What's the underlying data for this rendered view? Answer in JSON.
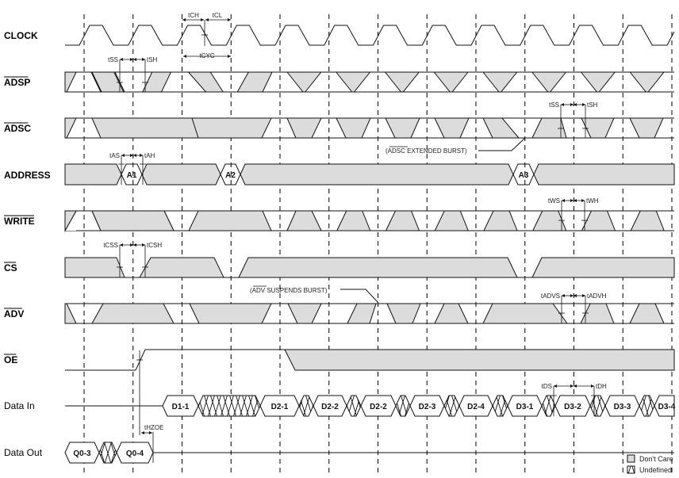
{
  "signals": [
    {
      "id": "clock",
      "label": "CLOCK",
      "overbar": false
    },
    {
      "id": "adsp",
      "label": "ADSP",
      "overbar": true
    },
    {
      "id": "adsc",
      "label": "ADSC",
      "overbar": true
    },
    {
      "id": "address",
      "label": "ADDRESS",
      "overbar": false
    },
    {
      "id": "write",
      "label": "WRITE",
      "overbar": true
    },
    {
      "id": "cs",
      "label": "CS",
      "overbar": true
    },
    {
      "id": "adv",
      "label": "ADV",
      "overbar": true
    },
    {
      "id": "oe",
      "label": "OE",
      "overbar": true
    },
    {
      "id": "datain",
      "label": "Data In",
      "overbar": false
    },
    {
      "id": "dataout",
      "label": "Data Out",
      "overbar": false
    }
  ],
  "timing_params": {
    "tch": "tCH",
    "tcl": "tCL",
    "tcyc": "tCYC",
    "tss": "tSS",
    "tsh": "tSH",
    "tas": "tAS",
    "tah": "tAH",
    "tws": "tWS",
    "twh": "tWH",
    "tcss": "tCSS",
    "tcsh": "tCSH",
    "tadvs": "tADVS",
    "tadvh": "tADVH",
    "thzoe": "tHZOE",
    "tds": "tDS",
    "tdh": "tDH"
  },
  "address_values": [
    "A1",
    "A2",
    "A3"
  ],
  "data_in_values": [
    "D1-1",
    "D2-1",
    "D2-2",
    "D2-2",
    "D2-3",
    "D2-4",
    "D3-1",
    "D3-2",
    "D3-3",
    "D3-4"
  ],
  "data_out_values": [
    "Q0-3",
    "Q0-4"
  ],
  "annotations": {
    "adsc_extended": {
      "prefix": "(",
      "overbar": "ADSC",
      "rest": " EXTENDED BURST)"
    },
    "adv_suspends": {
      "prefix": "(",
      "overbar": "ADV",
      "rest": " SUSPENDS BURST)"
    }
  },
  "legend": {
    "dont_care": "Don't Care",
    "undefined": "Undefined"
  },
  "colors": {
    "dont_care_fill": "#dcdcdc",
    "line": "#111111"
  }
}
